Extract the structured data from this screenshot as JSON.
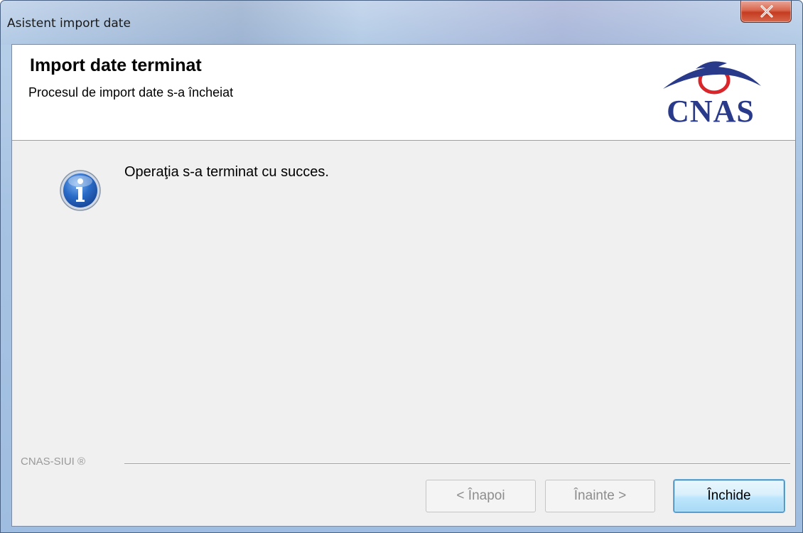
{
  "window": {
    "title": "Asistent import date",
    "close_icon": "close-icon"
  },
  "header": {
    "title": "Import date terminat",
    "subtitle": "Procesul de import date s-a încheiat",
    "logo_text": "CNAS"
  },
  "body": {
    "icon": "info-icon",
    "message": "Operaţia s-a terminat cu succes."
  },
  "footer": {
    "brand_label": "CNAS-SIUI ®",
    "back_label": "< Înapoi",
    "next_label": "Înainte >",
    "close_label": "Închide"
  },
  "colors": {
    "logo_blue": "#2a3a8a",
    "logo_red": "#d8262b",
    "close_red": "#c43b20",
    "default_button_border": "#3c7fb1"
  }
}
